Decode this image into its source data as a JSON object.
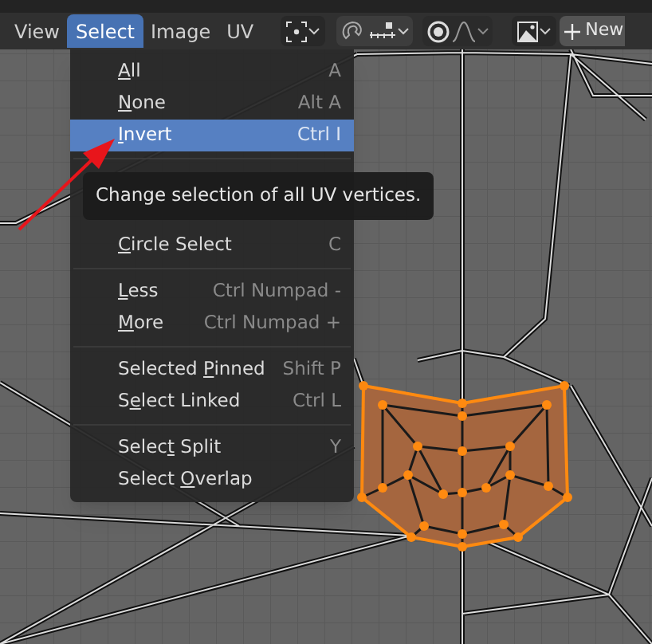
{
  "header": {
    "menus": [
      {
        "label": "View",
        "selected": false
      },
      {
        "label": "Select",
        "selected": true
      },
      {
        "label": "Image",
        "selected": false
      },
      {
        "label": "UV",
        "selected": false
      }
    ],
    "new_button": "New"
  },
  "menu": {
    "sections": [
      [
        {
          "key": "A",
          "after": "ll",
          "shortcut": "A",
          "highlighted": false
        },
        {
          "key": "N",
          "after": "one",
          "shortcut": "Alt A",
          "highlighted": false
        },
        {
          "key": "I",
          "after": "nvert",
          "shortcut": "Ctrl I",
          "highlighted": true
        }
      ],
      [
        {
          "key": "C",
          "after": "ircle Select",
          "shortcut": "C",
          "highlighted": false
        }
      ],
      [
        {
          "key": "L",
          "after": "ess",
          "shortcut": "Ctrl Numpad -",
          "highlighted": false
        },
        {
          "key": "M",
          "after": "ore",
          "shortcut": "Ctrl Numpad +",
          "highlighted": false
        }
      ],
      [
        {
          "before": "Selected ",
          "key": "P",
          "after": "inned",
          "shortcut": "Shift P",
          "highlighted": false
        },
        {
          "before": "S",
          "key": "e",
          "after": "lect Linked",
          "shortcut": "Ctrl L",
          "highlighted": false
        }
      ],
      [
        {
          "before": "Selec",
          "key": "t",
          "after": " Split",
          "shortcut": "Y",
          "highlighted": false
        },
        {
          "before": "Select ",
          "key": "O",
          "after": "verlap",
          "highlighted": false
        }
      ]
    ]
  },
  "tooltip": "Change selection of all UV vertices."
}
